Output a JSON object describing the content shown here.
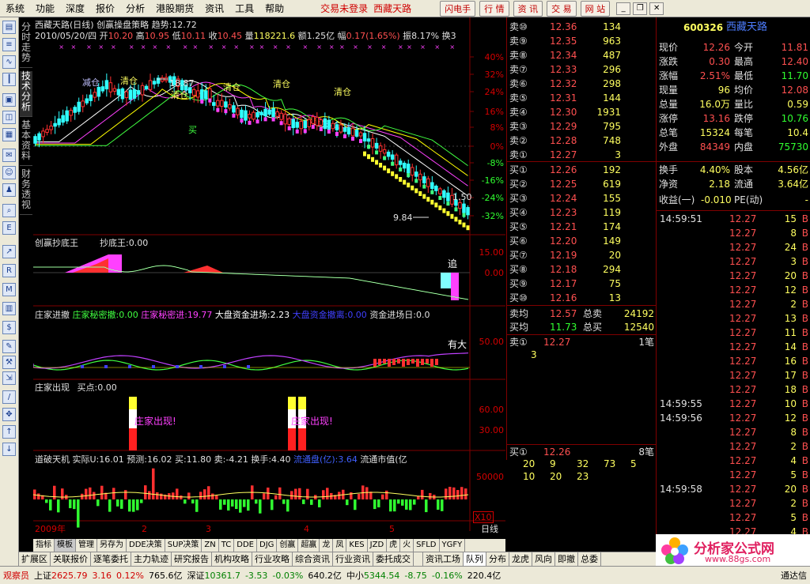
{
  "menu": {
    "items": [
      "系统",
      "功能",
      "深度",
      "报价",
      "分析",
      "港股期货",
      "资讯",
      "工具",
      "帮助"
    ],
    "status": "交易未登录",
    "stock_name": "西藏天路",
    "buttons": [
      "闪电手",
      "行 情",
      "资 讯",
      "交 易",
      "网 站"
    ]
  },
  "side_tabs": [
    "分时走势",
    "技术分析",
    "基本资料",
    "财务透视"
  ],
  "main": {
    "header": "西藏天路(日线) 创赢操盘策略 趋势:12.72",
    "ohlc": {
      "date": "2010/05/20/四",
      "open_label": "开",
      "open": "10.20",
      "high_label": "高",
      "high": "10.95",
      "low_label": "低",
      "low": "10.11",
      "close_label": "收",
      "close": "10.45",
      "vol_label": "量",
      "vol": "118221.6",
      "amt_label": "额",
      "amt": "1.25亿",
      "chg_label": "幅",
      "chg": "0.17(1.65%)",
      "amp_label": "振",
      "amp": "8.17%",
      "turn_label": "换",
      "turn": "3"
    },
    "annotations": {
      "high": "18.87",
      "low": "9.84",
      "right": "1.50",
      "reduce": "减仓",
      "clear": "清仓",
      "buy": "买"
    },
    "y_main": [
      "40%",
      "32%",
      "24%",
      "16%",
      "8%",
      "0%",
      "-8%",
      "-16%",
      "-24%",
      "-32%"
    ],
    "p2": {
      "title": "创赢抄底王",
      "v1": "抄底王:0.00",
      "y": [
        "15.00",
        "0.00"
      ],
      "chase": "追"
    },
    "p3": {
      "t1": "庄家进撤",
      "t2": "庄家秘密撤:0.00",
      "t3": "庄家秘密进:19.77",
      "t4": "大盘资金进场:2.23",
      "t5": "大盘资金撤离:0.00",
      "t6": "资金进场日:0.0",
      "y": [
        "50.00"
      ],
      "you": "有大"
    },
    "p4": {
      "title": "庄家出现",
      "v1": "买点:0.00",
      "y": [
        "60.00",
        "30.00"
      ],
      "label": "庄家出现!"
    },
    "p5": {
      "t1": "道破天机",
      "t2": "实际U:16.01",
      "t3": "预测:16.02",
      "t4": "买:11.80",
      "t5": "卖:-4.21",
      "t6": "换手:4.40",
      "t7": "流通盘(亿):3.64",
      "t8": "流通市值(亿",
      "y": [
        "50000"
      ],
      "x10": "X10"
    },
    "xaxis": {
      "year": "2009年",
      "m2": "2",
      "m3": "3",
      "m4": "4",
      "m5": "5",
      "period": "日线"
    }
  },
  "orderbook": {
    "sells": [
      [
        "卖⑩",
        "12.36",
        "134"
      ],
      [
        "卖⑨",
        "12.35",
        "963"
      ],
      [
        "卖⑧",
        "12.34",
        "487"
      ],
      [
        "卖⑦",
        "12.33",
        "296"
      ],
      [
        "卖⑥",
        "12.32",
        "298"
      ],
      [
        "卖⑤",
        "12.31",
        "144"
      ],
      [
        "卖④",
        "12.30",
        "1931"
      ],
      [
        "卖③",
        "12.29",
        "795"
      ],
      [
        "卖②",
        "12.28",
        "748"
      ],
      [
        "卖①",
        "12.27",
        "3"
      ]
    ],
    "buys": [
      [
        "买①",
        "12.26",
        "192"
      ],
      [
        "买②",
        "12.25",
        "619"
      ],
      [
        "买③",
        "12.24",
        "155"
      ],
      [
        "买④",
        "12.23",
        "119"
      ],
      [
        "买⑤",
        "12.21",
        "174"
      ],
      [
        "买⑥",
        "12.20",
        "149"
      ],
      [
        "买⑦",
        "12.19",
        "20"
      ],
      [
        "买⑧",
        "12.18",
        "294"
      ],
      [
        "买⑨",
        "12.17",
        "75"
      ],
      [
        "买⑩",
        "12.16",
        "13"
      ]
    ],
    "avg_sell_label": "卖均",
    "avg_sell": "12.57",
    "total_sell_label": "总卖",
    "total_sell": "24192",
    "avg_buy_label": "买均",
    "avg_buy": "11.73",
    "total_buy_label": "总买",
    "total_buy": "12540",
    "queue_sell": {
      "label": "卖①",
      "price": "12.27",
      "count": "1笔",
      "items": [
        "3"
      ]
    },
    "queue_buy": {
      "label": "买①",
      "price": "12.26",
      "count": "8笔",
      "rows": [
        [
          "20",
          "9",
          "32",
          "73",
          "5"
        ],
        [
          "10",
          "20",
          "23"
        ]
      ]
    }
  },
  "quote": {
    "code": "600326",
    "name": "西藏天路",
    "rows": [
      [
        "现价",
        "12.26",
        "今开",
        "11.81"
      ],
      [
        "涨跌",
        "0.30",
        "最高",
        "12.40"
      ],
      [
        "涨幅",
        "2.51%",
        "最低",
        "11.70"
      ],
      [
        "现量",
        "96",
        "均价",
        "12.08"
      ],
      [
        "总量",
        "16.0万",
        "量比",
        "0.59"
      ],
      [
        "涨停",
        "13.16",
        "跌停",
        "10.76"
      ],
      [
        "总笔",
        "15324",
        "每笔",
        "10.4"
      ],
      [
        "外盘",
        "84349",
        "内盘",
        "75730"
      ]
    ],
    "rows2": [
      [
        "换手",
        "4.40%",
        "股本",
        "4.56亿"
      ],
      [
        "净资",
        "2.18",
        "流通",
        "3.64亿"
      ]
    ],
    "rows3": [
      "收益(一)",
      "-0.010",
      "PE(动)",
      "-"
    ],
    "ticks": [
      [
        "14:59:51",
        "12.27",
        "15",
        "B"
      ],
      [
        "",
        "12.27",
        "8",
        "B"
      ],
      [
        "",
        "12.27",
        "24",
        "B"
      ],
      [
        "",
        "12.27",
        "3",
        "B"
      ],
      [
        "",
        "12.27",
        "20",
        "B"
      ],
      [
        "",
        "12.27",
        "12",
        "B"
      ],
      [
        "",
        "12.27",
        "2",
        "B"
      ],
      [
        "",
        "12.27",
        "13",
        "B"
      ],
      [
        "",
        "12.27",
        "11",
        "B"
      ],
      [
        "",
        "12.27",
        "14",
        "B"
      ],
      [
        "",
        "12.27",
        "16",
        "B"
      ],
      [
        "",
        "12.27",
        "17",
        "B"
      ],
      [
        "",
        "12.27",
        "18",
        "B"
      ],
      [
        "14:59:55",
        "12.27",
        "10",
        "B"
      ],
      [
        "14:59:56",
        "12.27",
        "12",
        "B"
      ],
      [
        "",
        "12.27",
        "8",
        "B"
      ],
      [
        "",
        "12.27",
        "2",
        "B"
      ],
      [
        "",
        "12.27",
        "4",
        "B"
      ],
      [
        "",
        "12.27",
        "5",
        "B"
      ],
      [
        "14:59:58",
        "12.27",
        "20",
        "B"
      ],
      [
        "",
        "12.27",
        "2",
        "B"
      ],
      [
        "",
        "12.27",
        "5",
        "B"
      ],
      [
        "",
        "12.27",
        "4",
        "B"
      ],
      [
        "",
        "12.27",
        "1",
        "B"
      ]
    ]
  },
  "btabs1": [
    "指标",
    "模板",
    "管理",
    "另存为",
    "DDE决策",
    "SUP决策",
    "ZN",
    "TC",
    "DDE",
    "DJG",
    "创赢",
    "超赢",
    "龙",
    "凤",
    "KES",
    "JZD",
    "虎",
    "火",
    "SFLD",
    "YGFY"
  ],
  "btabs2": [
    "扩展区",
    "关联报价",
    "逐笔委托",
    "主力轨迹",
    "研究报告",
    "机构攻略",
    "行业攻略",
    "综合资讯",
    "行业资讯",
    "委托成交",
    "",
    "资讯工场",
    "队列",
    "分布",
    "龙虎",
    "风向",
    "即撤",
    "总委"
  ],
  "statusbar": {
    "user": "观察员",
    "sh_label": "上证",
    "sh": "2625.79",
    "sh_chg": "3.16",
    "sh_pct": "0.12%",
    "sh_amt": "765.6亿",
    "sz_label": "深证",
    "sz": "10361.7",
    "sz_chg": "-3.53",
    "sz_pct": "-0.03%",
    "sz_amt": "640.2亿",
    "zx_label": "中小",
    "zx": "5344.54",
    "zx_chg": "-8.75",
    "zx_pct": "-0.16%",
    "zx_amt": "220.4亿",
    "conn": "通达信"
  },
  "logo": {
    "name": "分析家公式网",
    "url": "www.88gs.com"
  },
  "chart_data": {
    "type": "candlestick",
    "title": "西藏天路(日线)",
    "annotations": [
      "18.87",
      "9.84"
    ],
    "ylim_pct": [
      -32,
      40
    ]
  }
}
